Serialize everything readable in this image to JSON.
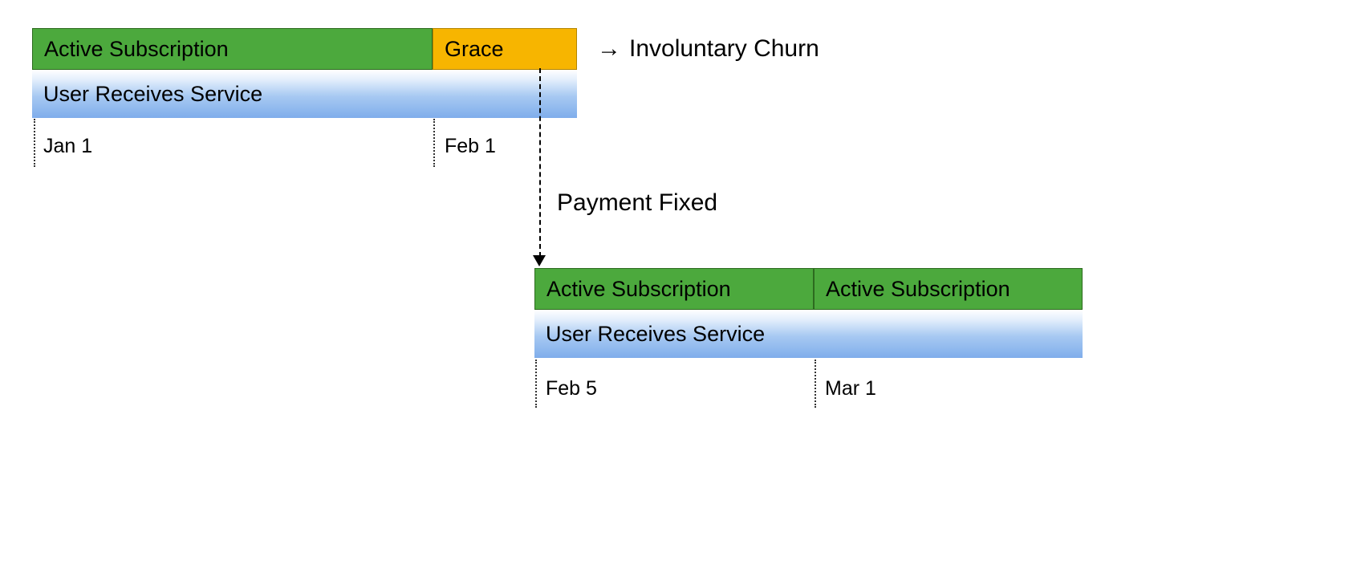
{
  "timeline1": {
    "active_subscription": "Active Subscription",
    "grace": "Grace",
    "user_receives_service": "User Receives Service",
    "date1": "Jan 1",
    "date2": "Feb 1"
  },
  "timeline2": {
    "active_subscription_1": "Active Subscription",
    "active_subscription_2": "Active Subscription",
    "user_receives_service": "User Receives Service",
    "date1": "Feb 5",
    "date2": "Mar 1"
  },
  "annotations": {
    "arrow": "→",
    "involuntary_churn": "Involuntary Churn",
    "payment_fixed": "Payment Fixed"
  },
  "colors": {
    "green": "#4ca93d",
    "yellow": "#f7b500",
    "blue": "#7fadeb"
  }
}
